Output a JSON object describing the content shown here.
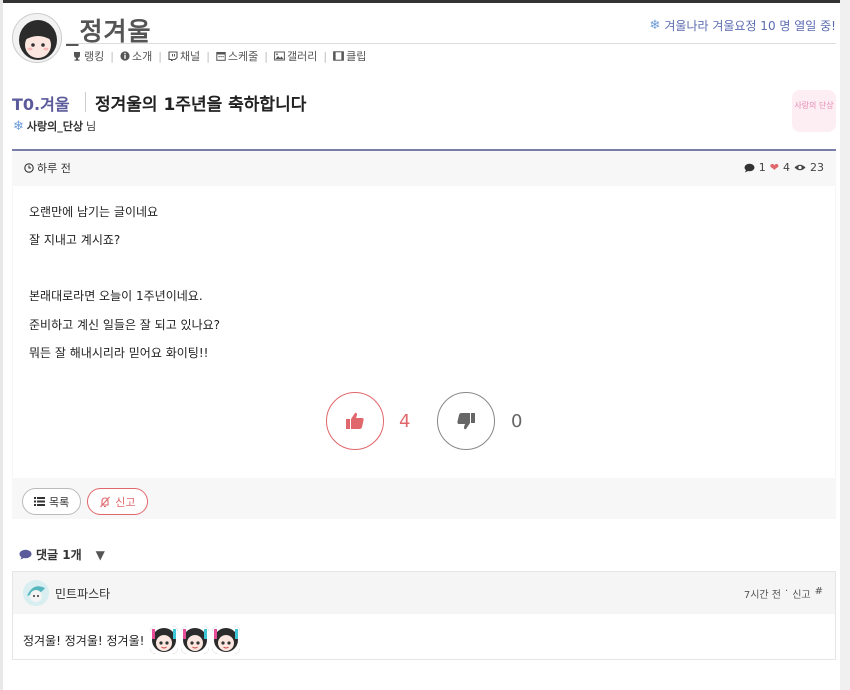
{
  "channel": {
    "name": "_정겨울",
    "nav": [
      {
        "icon": "trophy-icon",
        "label": "랭킹"
      },
      {
        "icon": "info-icon",
        "label": "소개"
      },
      {
        "icon": "twitch-icon",
        "label": "채널"
      },
      {
        "icon": "calendar-icon",
        "label": "스케줄"
      },
      {
        "icon": "image-icon",
        "label": "갤러리"
      },
      {
        "icon": "film-icon",
        "label": "클립"
      }
    ],
    "status_text": "겨울나라 겨울요정  10 명 열일 중!"
  },
  "post": {
    "board": "T0.겨울",
    "title": "정겨울의 1주년을 축하합니다",
    "author": "사랑의_단상",
    "author_suffix": "님",
    "sticker_text": "사랑의 단상",
    "time": "하루 전",
    "comment_count": "1",
    "like_count": "4",
    "view_count": "23",
    "body_lines": [
      "오랜만에 남기는 글이네요",
      "잘 지내고 계시죠?",
      "",
      "본래대로라면 오늘이 1주년이네요.",
      "준비하고 계신 일들은 잘 되고 있나요?",
      "뭐든 잘 해내시리라 믿어요 화이팅!!"
    ],
    "upvotes": "4",
    "downvotes": "0",
    "list_button": "목록",
    "report_button": "신고"
  },
  "comments": {
    "header": "댓글 1개",
    "items": [
      {
        "user": "민트파스타",
        "time": "7시간 전",
        "report": "신고",
        "permalink": "#",
        "text": "정겨울! 정겨울! 정겨울!",
        "emote_count": 3
      }
    ]
  },
  "colors": {
    "accent": "#5b5b9b",
    "like": "#e0676b",
    "status": "#5b6bb0"
  }
}
